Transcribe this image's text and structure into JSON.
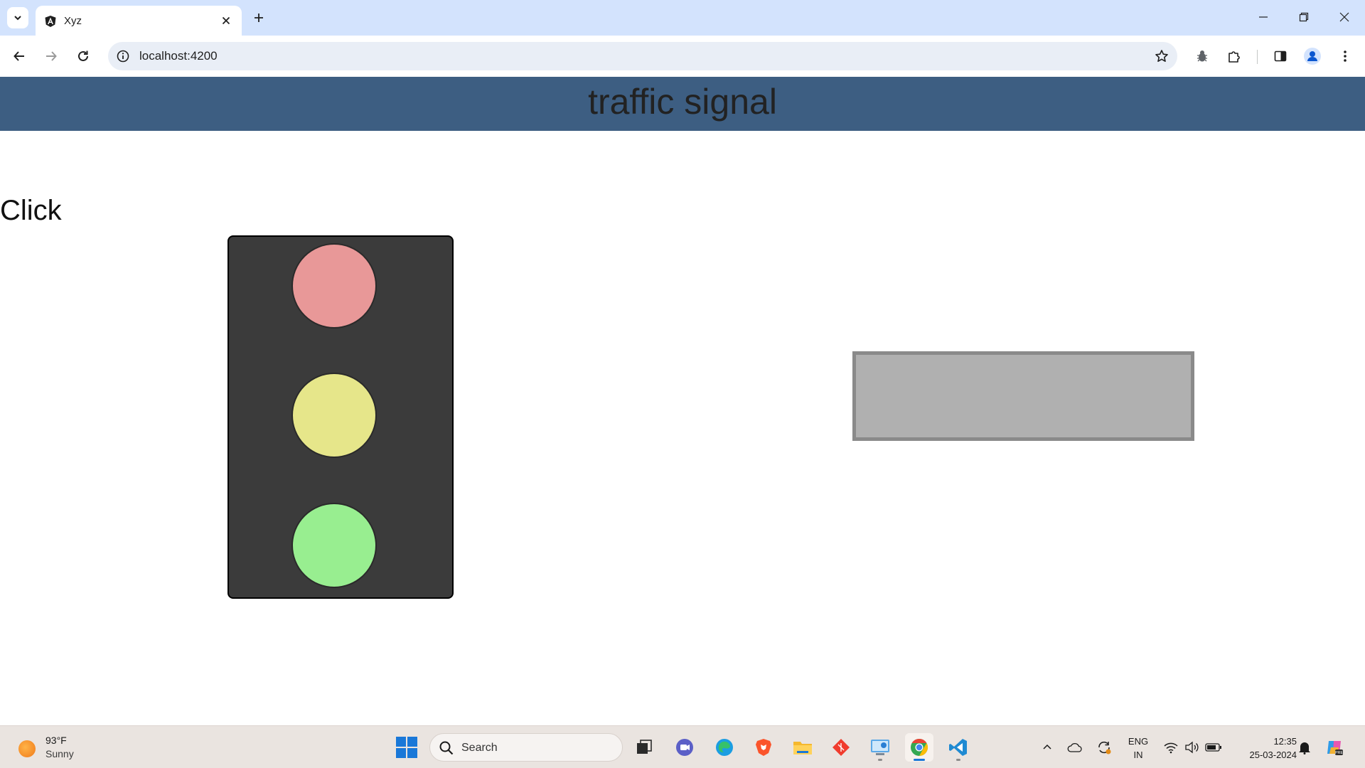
{
  "browser": {
    "tab": {
      "title": "Xyz",
      "favicon": "angular-icon"
    },
    "address_bar": {
      "url": "localhost:4200"
    },
    "toolbar_icons": [
      "back-icon",
      "forward-icon",
      "reload-icon",
      "site-info-icon",
      "bookmark-star-icon",
      "extension-bug-icon",
      "extensions-puzzle-icon",
      "side-panel-icon",
      "profile-icon",
      "menu-icon"
    ],
    "window_controls": [
      "minimize-icon",
      "restore-icon",
      "close-icon"
    ]
  },
  "app": {
    "header_title": "traffic signal",
    "click_label": "Click",
    "signal": {
      "lights": [
        {
          "name": "red",
          "color": "#e89898",
          "active": false
        },
        {
          "name": "yellow",
          "color": "#e6e68a",
          "active": false
        },
        {
          "name": "green",
          "color": "#98ee90",
          "active": false
        }
      ]
    },
    "result_box": {
      "text": ""
    },
    "colors": {
      "header_bg": "#3d5e82",
      "signal_bg": "#3b3b3b",
      "result_box_bg": "#b0b0b0"
    }
  },
  "taskbar": {
    "weather": {
      "temperature": "93°F",
      "condition": "Sunny"
    },
    "search_placeholder": "Search",
    "apps": [
      "task-view-icon",
      "teams-icon",
      "edge-icon",
      "brave-icon",
      "file-explorer-icon",
      "git-icon",
      "control-panel-icon",
      "chrome-icon",
      "vscode-icon"
    ],
    "tray": {
      "language_line1": "ENG",
      "language_line2": "IN",
      "time": "12:35",
      "date": "25-03-2024"
    }
  }
}
